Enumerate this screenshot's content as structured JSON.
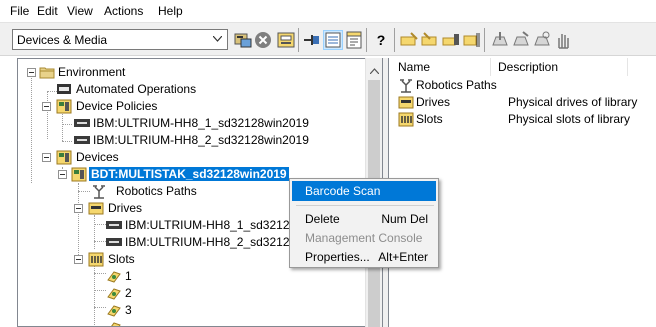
{
  "menu": [
    "File",
    "Edit",
    "View",
    "Actions",
    "Help"
  ],
  "toolbar": {
    "view_selector": "Devices & Media",
    "help_glyph": "?"
  },
  "tree": {
    "environment": "Environment",
    "automated_operations": "Automated Operations",
    "device_policies": "Device Policies",
    "policy_1": "IBM:ULTRIUM-HH8_1_sd32128win2019",
    "policy_2": "IBM:ULTRIUM-HH8_2_sd32128win2019",
    "devices": "Devices",
    "library": "BDT:MULTISTAK_sd32128win2019",
    "robotics_paths": "Robotics Paths",
    "drives": "Drives",
    "drive_1": "IBM:ULTRIUM-HH8_1_sd3212",
    "drive_2": "IBM:ULTRIUM-HH8_2_sd3212",
    "slots": "Slots",
    "slot_1": "1",
    "slot_2": "2",
    "slot_3": "3"
  },
  "list": {
    "col_name": "Name",
    "col_description": "Description",
    "rows": [
      {
        "name": "Robotics Paths",
        "description": ""
      },
      {
        "name": "Drives",
        "description": "Physical drives of library"
      },
      {
        "name": "Slots",
        "description": "Physical slots of library"
      }
    ]
  },
  "context_menu": {
    "barcode_scan": "Barcode Scan",
    "delete": "Delete",
    "delete_shortcut": "Num Del",
    "management_console": "Management Console",
    "properties": "Properties...",
    "properties_shortcut": "Alt+Enter"
  },
  "colors": {
    "selection": "#0078d7",
    "menu_bg": "#f2f2f2",
    "toolbar_bg": "#f0f0f0"
  }
}
